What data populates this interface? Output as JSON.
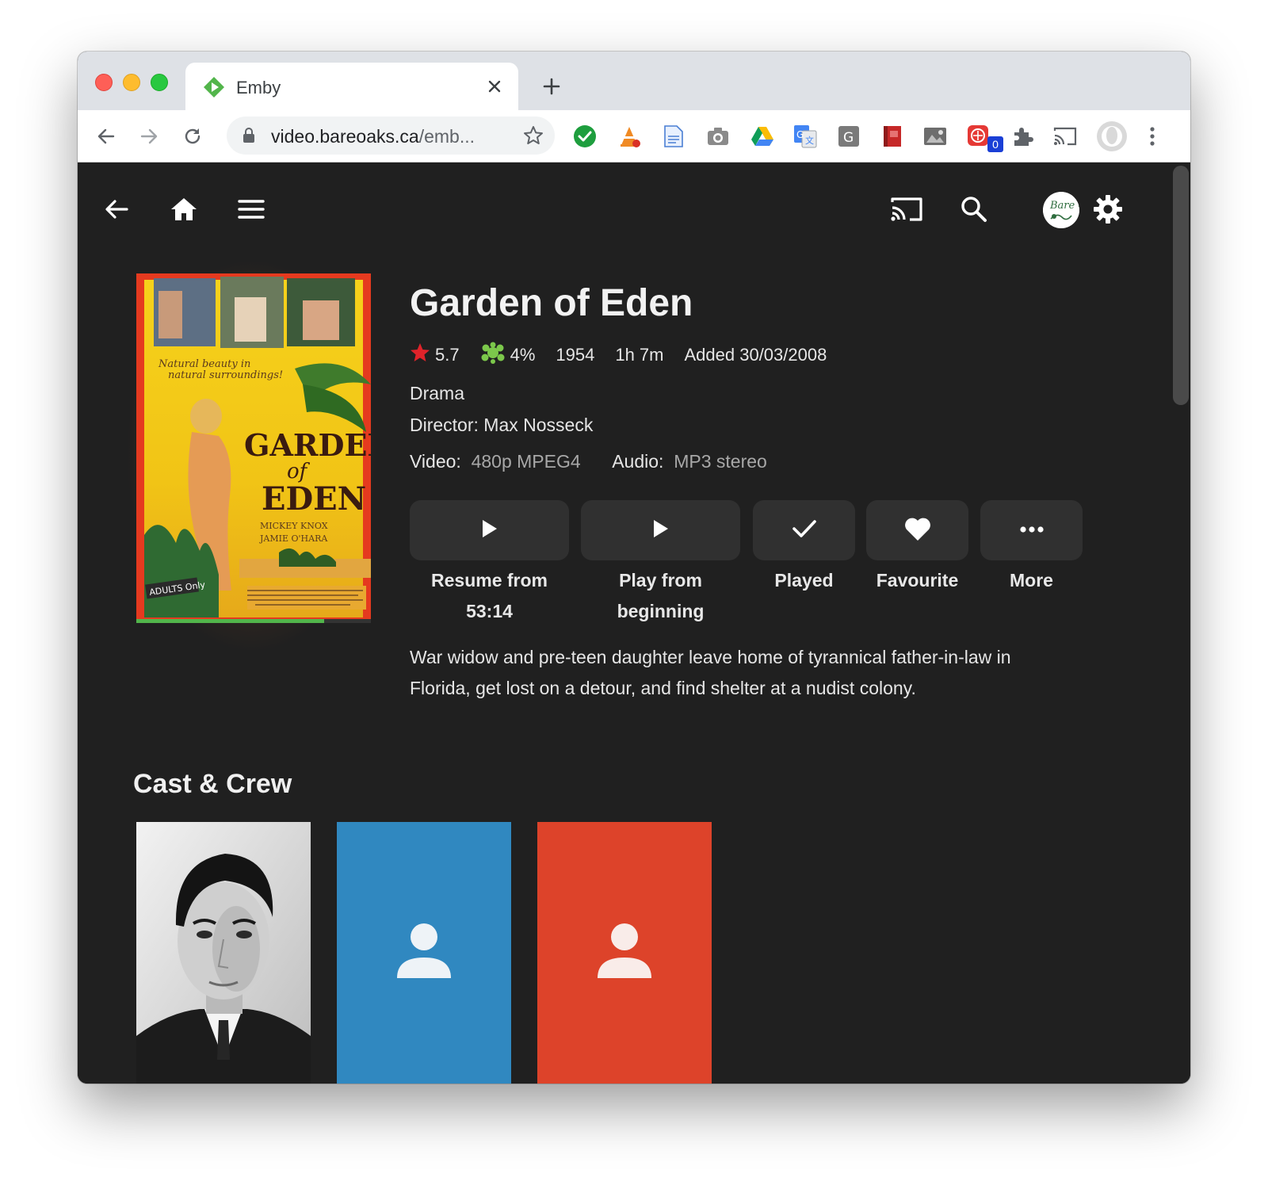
{
  "browser": {
    "tab_title": "Emby",
    "url_host": "video.bareoaks.ca",
    "url_rest": "/emb...",
    "extension_badge": "0"
  },
  "header": {
    "avatar_text": "Bare Oaks"
  },
  "movie": {
    "title": "Garden of Eden",
    "rating": "5.7",
    "critic_rating": "4%",
    "year": "1954",
    "runtime": "1h 7m",
    "added": "Added 30/03/2008",
    "genre": "Drama",
    "director": "Director: Max Nosseck",
    "video_label": "Video:",
    "video_value": "480p MPEG4",
    "audio_label": "Audio:",
    "audio_value": "MP3 stereo",
    "progress_fraction": 0.8,
    "overview_line1": "War widow and pre-teen daughter leave home of tyrannical father-in-law in",
    "overview_line2": "Florida, get lost on a detour, and find shelter at a nudist colony."
  },
  "poster": {
    "tagline1": "Natural beauty in",
    "tagline2": "natural surroundings!",
    "title1": "GARDEN",
    "title2": "of",
    "title3": "EDEN",
    "credit1": "MICKEY KNOX",
    "credit2": "JAMIE O'HARA",
    "badge": "ADULTS Only"
  },
  "actions": {
    "resume_line1": "Resume from",
    "resume_line2": "53:14",
    "play_line1": "Play from",
    "play_line2": "beginning",
    "played": "Played",
    "favourite": "Favourite",
    "more": "More"
  },
  "cast": {
    "section_title": "Cast & Crew",
    "cards": [
      {
        "kind": "photo",
        "color": "#e8e8e8"
      },
      {
        "kind": "placeholder",
        "color": "#3088c0"
      },
      {
        "kind": "placeholder",
        "color": "#dd432a"
      }
    ]
  },
  "colors": {
    "background": "#202020",
    "button": "#303030",
    "progress": "#52b54b",
    "rating_star": "#e0232a",
    "critic_splat": "#7cc84b"
  }
}
